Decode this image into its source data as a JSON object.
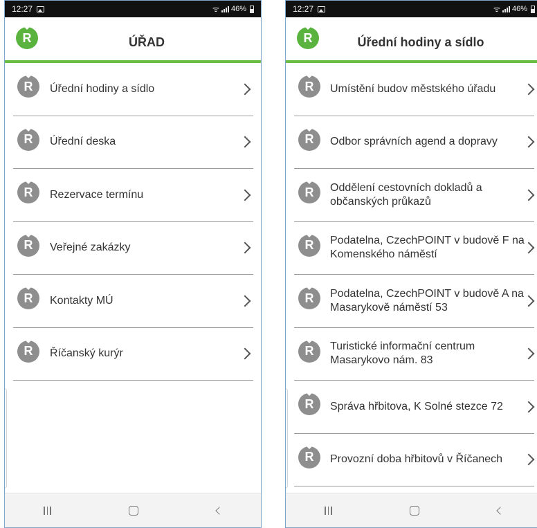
{
  "left_screen": {
    "status": {
      "time": "12:27",
      "battery": "46%"
    },
    "header": {
      "logo": "R",
      "title": "ÚŘAD"
    },
    "items": [
      {
        "icon": "R",
        "label": "Úřední hodiny a sídlo"
      },
      {
        "icon": "R",
        "label": "Úřední deska"
      },
      {
        "icon": "R",
        "label": "Rezervace termínu"
      },
      {
        "icon": "R",
        "label": "Veřejné zakázky"
      },
      {
        "icon": "R",
        "label": "Kontakty MÚ"
      },
      {
        "icon": "R",
        "label": "Říčanský kurýr"
      }
    ]
  },
  "right_screen": {
    "status": {
      "time": "12:27",
      "battery": "46%"
    },
    "header": {
      "logo": "R",
      "title": "Úřední hodiny a sídlo"
    },
    "items": [
      {
        "icon": "R",
        "label": "Umístění budov městského úřadu"
      },
      {
        "icon": "R",
        "label": "Odbor správních agend a dopravy"
      },
      {
        "icon": "R",
        "label": "Oddělení cestovních dokladů a občanských průkazů"
      },
      {
        "icon": "R",
        "label": "Podatelna, CzechPOINT v budově F na Komenského náměstí"
      },
      {
        "icon": "R",
        "label": "Podatelna, CzechPOINT v budově A na Masarykově náměstí 53"
      },
      {
        "icon": "R",
        "label": "Turistické informační centrum Masarykovo nám. 83"
      },
      {
        "icon": "R",
        "label": "Správa hřbitova, K Solné stezce 72"
      },
      {
        "icon": "R",
        "label": "Provozní doba hřbitovů v Říčanech"
      }
    ]
  },
  "icons": {
    "status_left": [
      "gallery-icon"
    ],
    "status_right": [
      "wifi-icon",
      "signal-icon",
      "battery-icon"
    ],
    "nav_bar": [
      "recent-apps-icon",
      "home-icon",
      "back-icon"
    ],
    "item_trailing": "chevron-right-icon"
  },
  "colors": {
    "accent_green": "#5bb33f",
    "header_rule": "#6cbd45",
    "item_icon_gray": "#8e8e8e",
    "status_bar": "#111111",
    "nav_bar": "#f3f3f3"
  }
}
